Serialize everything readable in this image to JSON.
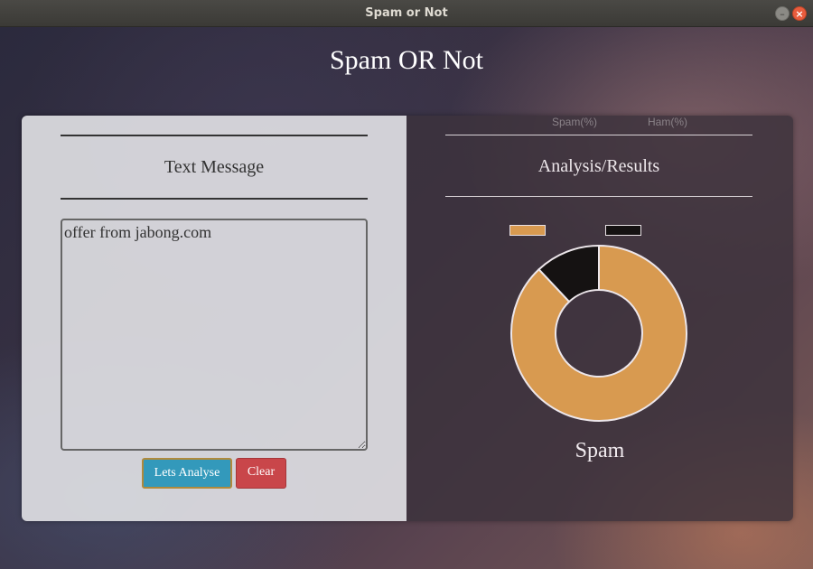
{
  "window": {
    "title": "Spam or Not",
    "minimize_glyph": "–",
    "close_glyph": "×"
  },
  "app": {
    "title": "Spam OR Not"
  },
  "input_panel": {
    "heading": "Text Message",
    "message_value": "offer from jabong.com",
    "analyse_label": "Lets Analyse",
    "clear_label": "Clear"
  },
  "results_panel": {
    "heading": "Analysis/Results",
    "result_label": "Spam"
  },
  "colors": {
    "spam": "#d89a50",
    "ham": "#151212",
    "analyse_button": "#3399bb",
    "clear_button": "#c9464a"
  },
  "chart_data": {
    "type": "pie",
    "variant": "doughnut",
    "legend_position": "top",
    "categories": [
      "Spam(%)",
      "Ham(%)"
    ],
    "values": [
      88,
      12
    ],
    "colors": [
      "#d89a50",
      "#151212"
    ]
  }
}
